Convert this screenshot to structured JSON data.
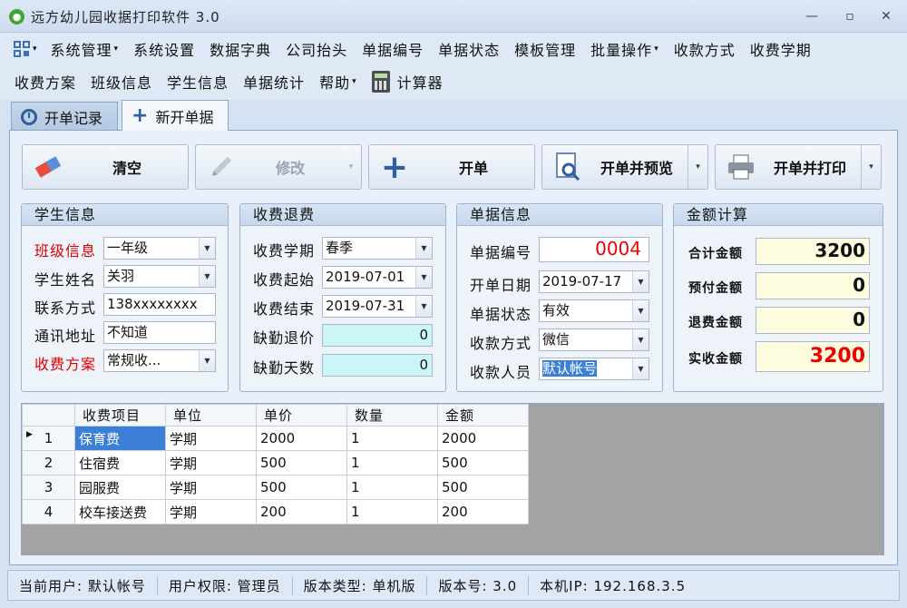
{
  "window": {
    "title": "远方幼儿园收据打印软件 3.0"
  },
  "menu": {
    "row1": [
      "系统管理",
      "系统设置",
      "数据字典",
      "公司抬头",
      "单据编号",
      "单据状态",
      "模板管理",
      "批量操作",
      "收款方式",
      "收费学期"
    ],
    "row2": [
      "收费方案",
      "班级信息",
      "学生信息",
      "单据统计",
      "帮助",
      "计算器"
    ]
  },
  "tabs": {
    "history": "开单记录",
    "new": "新开单据"
  },
  "toolbar": {
    "clear": "清空",
    "edit": "修改",
    "create": "开单",
    "create_preview": "开单并预览",
    "create_print": "开单并打印"
  },
  "student": {
    "title": "学生信息",
    "class_label": "班级信息",
    "class_value": "一年级",
    "name_label": "学生姓名",
    "name_value": "关羽",
    "contact_label": "联系方式",
    "contact_value": "138xxxxxxxx",
    "address_label": "通讯地址",
    "address_value": "不知道",
    "plan_label": "收费方案",
    "plan_value": "常规收..."
  },
  "fee": {
    "title": "收费退费",
    "term_label": "收费学期",
    "term_value": "春季",
    "start_label": "收费起始",
    "start_value": "2019-07-01",
    "end_label": "收费结束",
    "end_value": "2019-07-31",
    "refund_label": "缺勤退价",
    "refund_value": "0",
    "absent_label": "缺勤天数",
    "absent_value": "0"
  },
  "bill": {
    "title": "单据信息",
    "no_label": "单据编号",
    "no_value": "0004",
    "date_label": "开单日期",
    "date_value": "2019-07-17",
    "status_label": "单据状态",
    "status_value": "有效",
    "method_label": "收款方式",
    "method_value": "微信",
    "payee_label": "收款人员",
    "payee_value": "默认帐号"
  },
  "amount": {
    "title": "金额计算",
    "total_label": "合计金额",
    "total_value": "3200",
    "prepaid_label": "预付金额",
    "prepaid_value": "0",
    "refund_label": "退费金额",
    "refund_value": "0",
    "actual_label": "实收金额",
    "actual_value": "3200"
  },
  "grid": {
    "headers": [
      "收费项目",
      "单位",
      "单价",
      "数量",
      "金额"
    ],
    "rows": [
      {
        "no": "1",
        "item": "保育费",
        "unit": "学期",
        "price": "2000",
        "qty": "1",
        "amount": "2000"
      },
      {
        "no": "2",
        "item": "住宿费",
        "unit": "学期",
        "price": "500",
        "qty": "1",
        "amount": "500"
      },
      {
        "no": "3",
        "item": "园服费",
        "unit": "学期",
        "price": "500",
        "qty": "1",
        "amount": "500"
      },
      {
        "no": "4",
        "item": "校车接送费",
        "unit": "学期",
        "price": "200",
        "qty": "1",
        "amount": "200"
      }
    ]
  },
  "status": {
    "user": "当前用户: 默认帐号",
    "perm": "用户权限: 管理员",
    "edition": "版本类型: 单机版",
    "version": "版本号: 3.0",
    "ip": "本机IP: 192.168.3.5"
  }
}
